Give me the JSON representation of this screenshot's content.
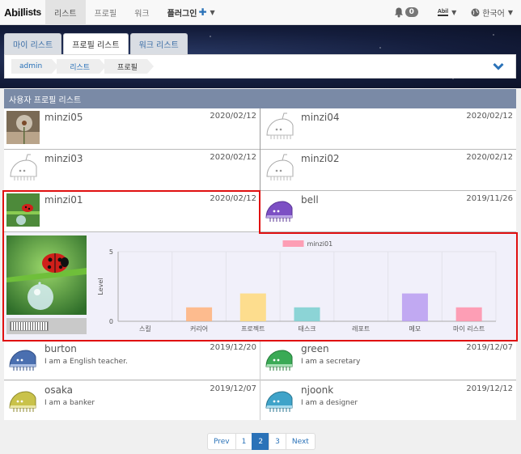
{
  "navbar": {
    "logo_main": "Abil",
    "logo_sub": "lists",
    "items": [
      {
        "label": "리스트",
        "active": true
      },
      {
        "label": "프로필"
      },
      {
        "label": "워크"
      },
      {
        "label": "플러그인"
      }
    ],
    "plugin_plus": "✚",
    "notification_count": "0",
    "user_label": "Abil",
    "language": "한국어"
  },
  "tabs": [
    {
      "label": "마이 리스트"
    },
    {
      "label": "프로필 리스트",
      "active": true
    },
    {
      "label": "워크 리스트"
    }
  ],
  "breadcrumb": [
    "admin",
    "리스트",
    "프로필"
  ],
  "panel": {
    "title": "사용자 프로필 리스트"
  },
  "profiles": [
    {
      "name": "minzi05",
      "date": "2020/02/12",
      "avatar": "dandelion-photo"
    },
    {
      "name": "minzi04",
      "date": "2020/02/12",
      "avatar": "robot-outline"
    },
    {
      "name": "minzi03",
      "date": "2020/02/12",
      "avatar": "robot-outline"
    },
    {
      "name": "minzi02",
      "date": "2020/02/12",
      "avatar": "robot-outline"
    },
    {
      "name": "minzi01",
      "date": "2020/02/12",
      "avatar": "ladybug-photo"
    },
    {
      "name": "bell",
      "date": "2019/11/26",
      "avatar": "robot-purple",
      "color": "#7c4fc4"
    },
    {
      "name": "burton",
      "date": "2019/12/20",
      "desc": "I am a English teacher.",
      "color": "#4a6fb0"
    },
    {
      "name": "green",
      "date": "2019/12/07",
      "desc": "I am a secretary",
      "color": "#3aaa55"
    },
    {
      "name": "osaka",
      "date": "2019/12/07",
      "desc": "I am a banker",
      "color": "#c9c24a"
    },
    {
      "name": "njoonk",
      "date": "2019/12/12",
      "desc": "I am a designer",
      "color": "#3fa3c9"
    }
  ],
  "chart_data": {
    "type": "bar",
    "categories": [
      "스킬",
      "커리어",
      "프로젝트",
      "태스크",
      "레포트",
      "메모",
      "마이 리스트"
    ],
    "series": [
      {
        "name": "minzi01",
        "values": [
          0,
          1,
          2,
          1,
          0,
          2,
          1
        ]
      }
    ],
    "colors": [
      "#ff9b9b",
      "#ffb27a",
      "#ffd97a",
      "#7acfcf",
      "#9ec4f0",
      "#b89cf0",
      "#ff8fa8"
    ],
    "legend_color": "#ff8fa8",
    "ylabel": "Level",
    "ylim": [
      0,
      5
    ],
    "yticks": [
      "0",
      "5"
    ],
    "legend_position": "top"
  },
  "pagination": {
    "prev": "Prev",
    "pages": [
      "1",
      "2",
      "3"
    ],
    "current": "2",
    "next": "Next"
  }
}
